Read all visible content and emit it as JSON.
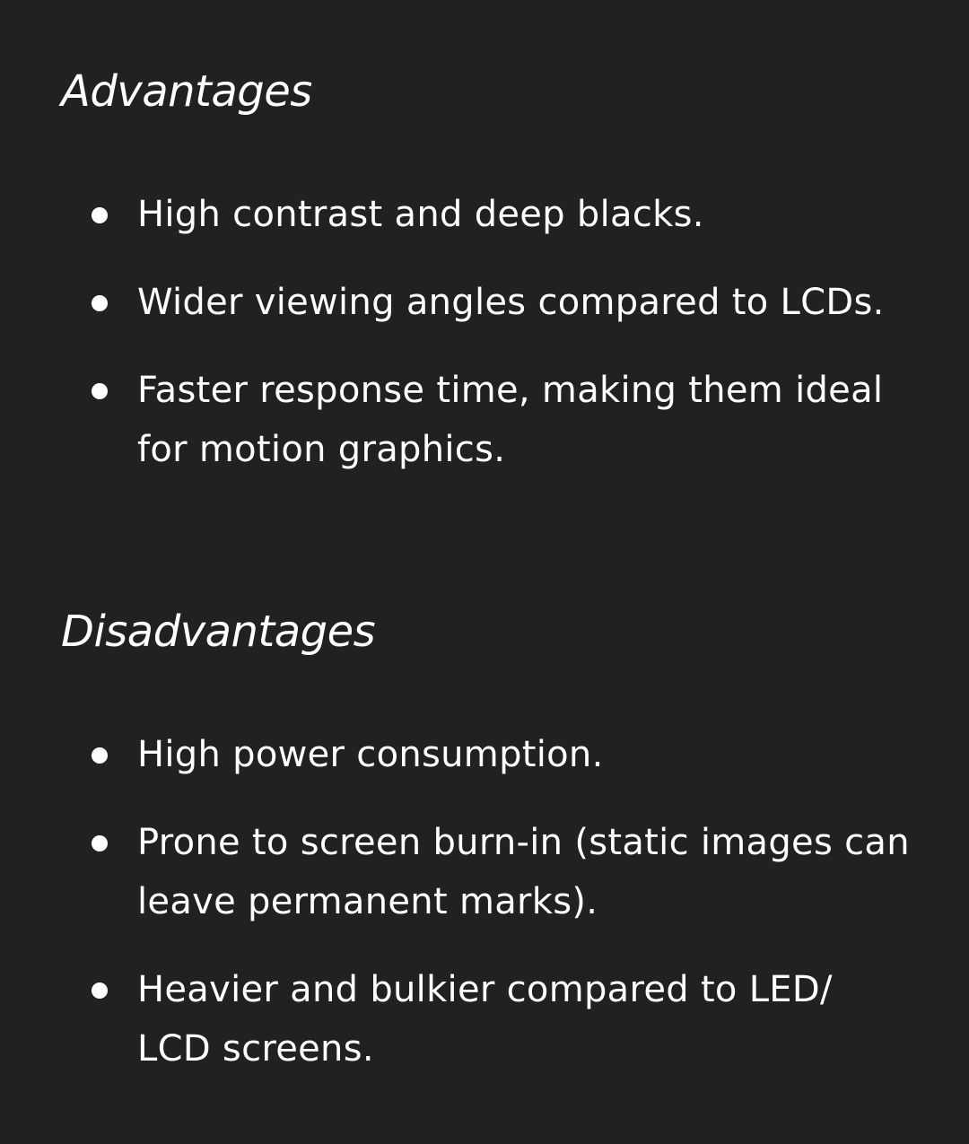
{
  "advantages": {
    "heading": "Advantages",
    "items": [
      "High contrast and deep blacks.",
      "Wider viewing angles compared to LCDs.",
      "Faster response time, making them ideal for motion graphics."
    ]
  },
  "disadvantages": {
    "heading": "Disadvantages",
    "items": [
      "High power consumption.",
      "Prone to screen burn-in (static images can leave permanent marks).",
      "Heavier and bulkier compared to LED/ LCD screens."
    ]
  },
  "colors": {
    "background": "#212121",
    "text": "#ffffff"
  }
}
